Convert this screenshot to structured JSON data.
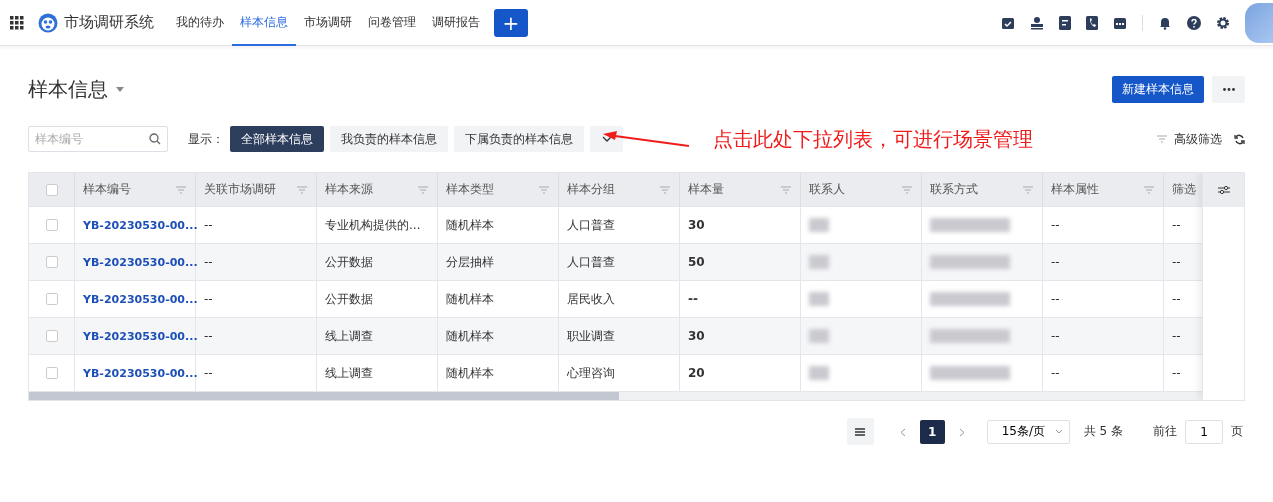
{
  "header": {
    "app_name": "市场调研系统",
    "nav": [
      {
        "label": "我的待办",
        "selected": false
      },
      {
        "label": "样本信息",
        "selected": true
      },
      {
        "label": "市场调研",
        "selected": false
      },
      {
        "label": "问卷管理",
        "selected": false
      },
      {
        "label": "调研报告",
        "selected": false
      }
    ],
    "add_button": "+"
  },
  "page": {
    "title": "样本信息",
    "primary_button": "新建样本信息"
  },
  "toolbar": {
    "search": {
      "placeholder": "样本编号"
    },
    "show_label": "显示：",
    "views": [
      {
        "label": "全部样本信息",
        "selected": true
      },
      {
        "label": "我负责的样本信息",
        "selected": false
      },
      {
        "label": "下属负责的样本信息",
        "selected": false
      }
    ],
    "advanced_filter": "高级筛选"
  },
  "annotation": {
    "text": "点击此处下拉列表，可进行场景管理"
  },
  "table": {
    "all_checked": false,
    "columns": [
      "样本编号",
      "关联市场调研",
      "样本来源",
      "样本类型",
      "样本分组",
      "样本量",
      "联系人",
      "联系方式",
      "样本属性",
      "筛选"
    ],
    "rows": [
      {
        "checked": false,
        "id": "YB-20230530-00...",
        "survey": "--",
        "source": "专业机构提供的...",
        "type": "随机样本",
        "group": "人口普查",
        "size": "30",
        "attribute": "--",
        "column_10": "--"
      },
      {
        "checked": false,
        "id": "YB-20230530-00...",
        "survey": "--",
        "source": "公开数据",
        "type": "分层抽样",
        "group": "人口普查",
        "size": "50",
        "attribute": "--",
        "column_10": "--"
      },
      {
        "checked": false,
        "id": "YB-20230530-00...",
        "survey": "--",
        "source": "公开数据",
        "type": "随机样本",
        "group": "居民收入",
        "size": "--",
        "attribute": "--",
        "column_10": "--"
      },
      {
        "checked": false,
        "id": "YB-20230530-00...",
        "survey": "--",
        "source": "线上调查",
        "type": "随机样本",
        "group": "职业调查",
        "size": "30",
        "attribute": "--",
        "column_10": "--"
      },
      {
        "checked": false,
        "id": "YB-20230530-00...",
        "survey": "--",
        "source": "线上调查",
        "type": "随机样本",
        "group": "心理咨询",
        "size": "20",
        "attribute": "--",
        "column_10": "--"
      }
    ]
  },
  "pagination": {
    "pages": [
      {
        "label": "1",
        "selected": true
      }
    ],
    "page_size": "15条/页",
    "total": "共 5 条",
    "goto_label": "前往",
    "goto_value": "1",
    "goto_suffix": "页"
  }
}
